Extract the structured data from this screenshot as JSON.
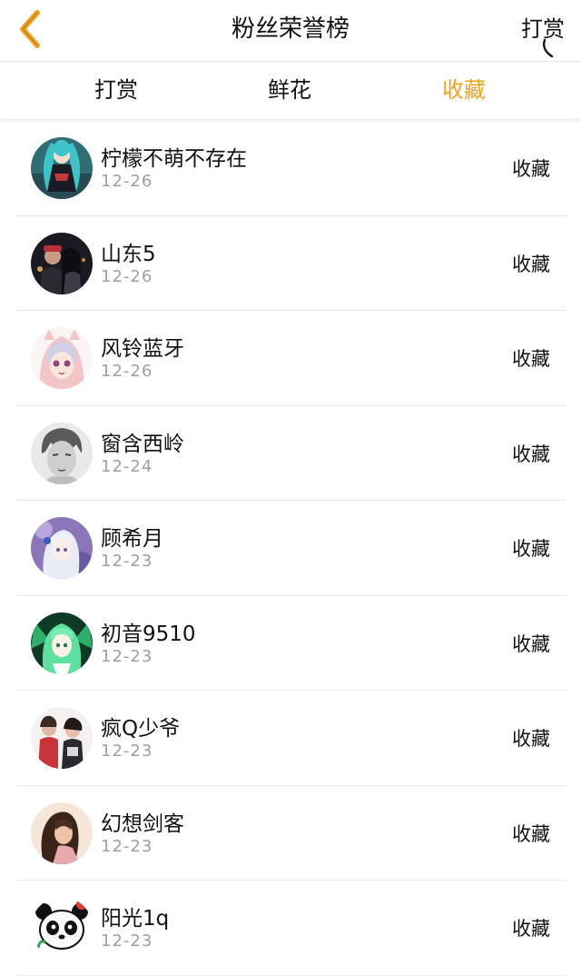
{
  "header": {
    "title": "粉丝荣誉榜",
    "right_label": "打赏",
    "back_icon": "chevron-left-icon",
    "accent_color": "#f0a11f"
  },
  "tabs": [
    {
      "label": "打赏",
      "active": false
    },
    {
      "label": "鲜花",
      "active": false
    },
    {
      "label": "收藏",
      "active": true
    }
  ],
  "fans": [
    {
      "name": "柠檬不萌不存在",
      "date": "12-26",
      "action": "收藏",
      "avatar": "anime-avatar-teal-twintail"
    },
    {
      "name": "山东5",
      "date": "12-26",
      "action": "收藏",
      "avatar": "photo-avatar-couple-night"
    },
    {
      "name": "风铃蓝牙",
      "date": "12-26",
      "action": "收藏",
      "avatar": "anime-avatar-pink-hood"
    },
    {
      "name": "窗含西岭",
      "date": "12-24",
      "action": "收藏",
      "avatar": "sketch-avatar-boy"
    },
    {
      "name": "顾希月",
      "date": "12-23",
      "action": "收藏",
      "avatar": "anime-avatar-purple-girl"
    },
    {
      "name": "初音9510",
      "date": "12-23",
      "action": "收藏",
      "avatar": "anime-avatar-green-miku"
    },
    {
      "name": "疯Q少爷",
      "date": "12-23",
      "action": "收藏",
      "avatar": "photo-avatar-friends"
    },
    {
      "name": "幻想剑客",
      "date": "12-23",
      "action": "收藏",
      "avatar": "photo-avatar-girl-longhair"
    },
    {
      "name": "阳光1q",
      "date": "12-23",
      "action": "收藏",
      "avatar": "panda-avatar"
    }
  ]
}
